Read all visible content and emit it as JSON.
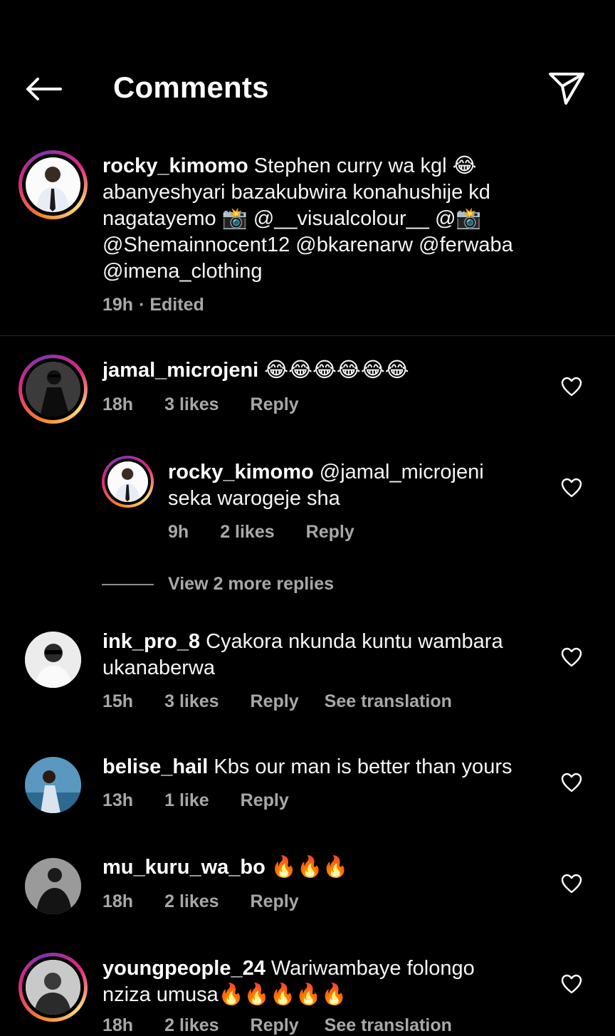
{
  "header": {
    "title": "Comments"
  },
  "caption": {
    "username": "rocky_kimomo",
    "lines": [
      "Stephen curry wa kgl 😂",
      "abanyeshyari bazakubwira konahushije kd",
      "nagatayemo 📸 @__visualcolour__ @📸",
      "@Shemainnocent12 @bkarenarw @ferwaba",
      "@imena_clothing"
    ],
    "time": "19h",
    "edited": "· Edited"
  },
  "comments": [
    {
      "username": "jamal_microjeni",
      "text": "😂😂😂😂😂😂",
      "time": "18h",
      "likes": "3 likes",
      "reply": "Reply"
    },
    {
      "username": "rocky_kimomo",
      "text_line1": "@jamal_microjeni",
      "text_line2": "seka warogeje sha",
      "time": "9h",
      "likes": "2 likes",
      "reply": "Reply"
    },
    {
      "username": "ink_pro_8",
      "text_line1": "Cyakora nkunda kuntu wambara",
      "text_line2": "ukanaberwa",
      "time": "15h",
      "likes": "3 likes",
      "reply": "Reply",
      "translate": "See translation"
    },
    {
      "username": "belise_hail",
      "text": "Kbs our man is better than yours",
      "time": "13h",
      "likes": "1 like",
      "reply": "Reply"
    },
    {
      "username": "mu_kuru_wa_bo",
      "text": "🔥🔥🔥",
      "time": "18h",
      "likes": "2 likes",
      "reply": "Reply"
    },
    {
      "username": "youngpeople_24",
      "text_line1": "Wariwambaye folongo",
      "text_line2": "nziza umusa🔥🔥🔥🔥🔥",
      "time": "18h",
      "likes": "2 likes",
      "reply": "Reply",
      "translate": "See translation"
    }
  ],
  "view_more": "View 2 more replies"
}
